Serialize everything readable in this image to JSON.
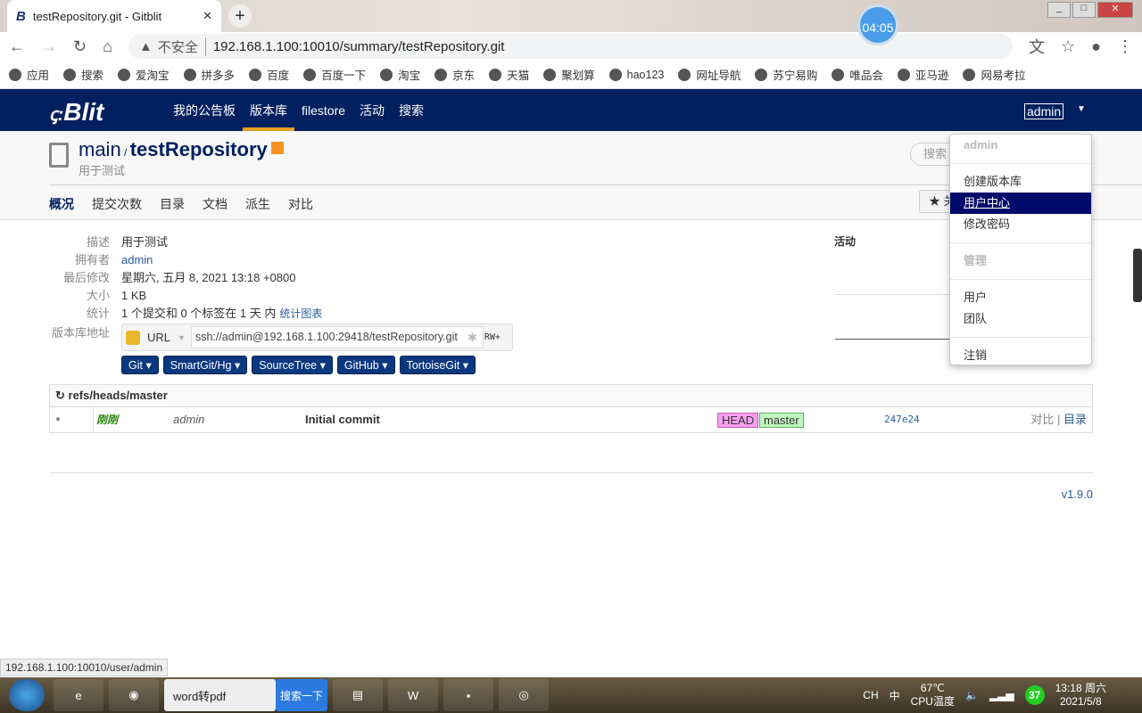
{
  "browser": {
    "tab_title": "testRepository.git - Gitblit",
    "clock": "04:05",
    "insecure": "不安全",
    "url": "192.168.1.100:10010/summary/testRepository.git",
    "bookmarks": [
      "应用",
      "搜索",
      "爱淘宝",
      "拼多多",
      "百度",
      "百度一下",
      "淘宝",
      "京东",
      "天猫",
      "聚划算",
      "hao123",
      "网址导航",
      "苏宁易购",
      "唯品会",
      "亚马逊",
      "网易考拉"
    ]
  },
  "navbar": {
    "logo": "Blit",
    "items": [
      "我的公告板",
      "版本库",
      "filestore",
      "活动",
      "搜索"
    ],
    "active": "版本库",
    "user": "admin"
  },
  "repo": {
    "owner_path": "main",
    "name": "testRepository",
    "description": "用于测试",
    "search_placeholder": "搜索",
    "star_label": "★ 关",
    "tabs": [
      "概况",
      "提交次数",
      "目录",
      "文档",
      "派生",
      "对比"
    ],
    "active_tab": "概况"
  },
  "summary": {
    "rows": [
      {
        "k": "描述",
        "v": "用于测试"
      },
      {
        "k": "拥有者",
        "v": "admin"
      },
      {
        "k": "最后修改",
        "v": "星期六, 五月 8, 2021 13:18 +0800"
      },
      {
        "k": "大小",
        "v": "1 KB"
      },
      {
        "k": "统计",
        "v": "1 个提交和 0 个标签在 1 天 内"
      }
    ],
    "stats_link": "统计图表",
    "url_label": "版本库地址",
    "protocol": "URL",
    "clone_url": "ssh://admin@192.168.1.100:29418/testRepository.git",
    "permission": "RW+",
    "clients": [
      "Git",
      "SmartGit/Hg",
      "SourceTree",
      "GitHub",
      "TortoiseGit"
    ],
    "activity": "活动"
  },
  "refs": {
    "branch": "refs/heads/master",
    "commit": {
      "when": "刚刚",
      "author": "admin",
      "message": "Initial commit",
      "labels": [
        "HEAD",
        "master"
      ],
      "sha": "247e24",
      "compare": "对比",
      "tree": "目录"
    }
  },
  "footer": {
    "version": "v1.9.0"
  },
  "dropdown": {
    "header": "admin",
    "items": [
      "创建版本库",
      "用户中心",
      "修改密码"
    ],
    "admin_header": "管理",
    "admin_items": [
      "用户",
      "团队"
    ],
    "logout": "注销",
    "highlighted": "用户中心"
  },
  "status_url": "192.168.1.100:10010/user/admin",
  "taskbar": {
    "word": "word转pdf",
    "search": "搜索一下",
    "lang": "CH",
    "ime": "中",
    "temp": "67℃",
    "temp_label": "CPU温度",
    "badge": "37",
    "time": "13:18 周六",
    "date": "2021/5/8"
  }
}
